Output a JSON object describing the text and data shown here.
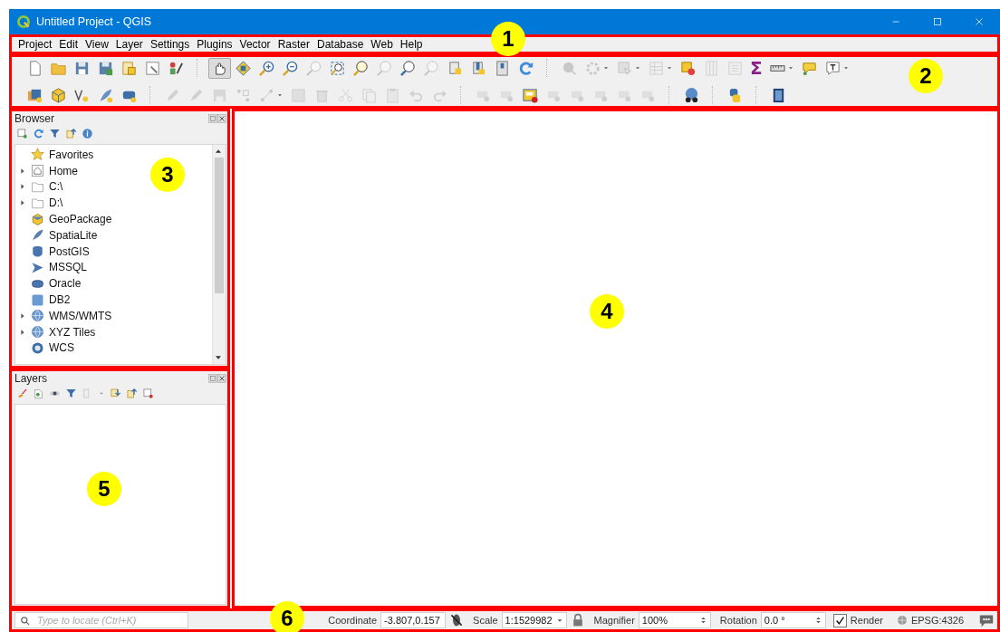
{
  "window": {
    "title": "Untitled Project - QGIS"
  },
  "menu": [
    "Project",
    "Edit",
    "View",
    "Layer",
    "Settings",
    "Plugins",
    "Vector",
    "Raster",
    "Database",
    "Web",
    "Help"
  ],
  "toolbars": [
    {
      "groups": [
        [
          {
            "disabled": false,
            "selected": false
          },
          {
            "disabled": false,
            "selected": false
          },
          {
            "disabled": false,
            "selected": false
          },
          {
            "disabled": false,
            "selected": false
          },
          {
            "disabled": false,
            "selected": false
          },
          {
            "disabled": false,
            "selected": false
          },
          {
            "disabled": false,
            "selected": false
          }
        ],
        [
          {
            "disabled": false,
            "selected": true
          },
          {
            "disabled": false,
            "selected": false
          },
          {
            "disabled": false,
            "selected": false
          },
          {
            "disabled": false,
            "selected": false
          },
          {
            "disabled": true,
            "selected": false
          },
          {
            "disabled": false,
            "selected": false
          },
          {
            "disabled": false,
            "selected": false
          },
          {
            "disabled": true,
            "selected": false
          },
          {
            "disabled": false,
            "selected": false
          },
          {
            "disabled": true,
            "selected": false
          },
          {
            "disabled": false,
            "selected": false
          },
          {
            "disabled": false,
            "selected": false
          },
          {
            "disabled": false,
            "selected": false
          },
          {
            "disabled": false,
            "selected": false
          }
        ],
        [
          {
            "disabled": true,
            "selected": false
          },
          {
            "disabled": true,
            "selected": false,
            "dropdown": true
          },
          {
            "disabled": true,
            "selected": false,
            "dropdown": true
          },
          {
            "disabled": true,
            "selected": false,
            "dropdown": true
          },
          {
            "disabled": false,
            "selected": false
          },
          {
            "disabled": true,
            "selected": false
          },
          {
            "disabled": true,
            "selected": false
          },
          {
            "disabled": false,
            "selected": false,
            "label": "Σ"
          },
          {
            "disabled": false,
            "selected": false,
            "dropdown": true
          },
          {
            "disabled": false,
            "selected": false
          },
          {
            "disabled": false,
            "selected": false,
            "dropdown": true
          }
        ]
      ]
    },
    {
      "groups": [
        [
          {
            "disabled": false,
            "selected": false
          },
          {
            "disabled": false,
            "selected": false
          },
          {
            "disabled": false,
            "selected": false
          },
          {
            "disabled": false,
            "selected": false
          },
          {
            "disabled": false,
            "selected": false
          }
        ],
        [
          {
            "disabled": true,
            "selected": false
          },
          {
            "disabled": true,
            "selected": false
          },
          {
            "disabled": true,
            "selected": false
          },
          {
            "disabled": true,
            "selected": false
          },
          {
            "disabled": true,
            "selected": false,
            "dropdown": true
          },
          {
            "disabled": true,
            "selected": false
          },
          {
            "disabled": true,
            "selected": false
          },
          {
            "disabled": true,
            "selected": false
          },
          {
            "disabled": true,
            "selected": false
          },
          {
            "disabled": true,
            "selected": false
          },
          {
            "disabled": true,
            "selected": false
          },
          {
            "disabled": true,
            "selected": false
          }
        ],
        [
          {
            "disabled": true,
            "selected": false
          },
          {
            "disabled": true,
            "selected": false
          },
          {
            "disabled": false,
            "selected": false
          },
          {
            "disabled": true,
            "selected": false
          },
          {
            "disabled": true,
            "selected": false
          },
          {
            "disabled": true,
            "selected": false
          },
          {
            "disabled": true,
            "selected": false
          },
          {
            "disabled": true,
            "selected": false
          }
        ],
        [
          {
            "disabled": false,
            "selected": false
          }
        ],
        [
          {
            "disabled": false,
            "selected": false
          }
        ],
        [
          {
            "disabled": false,
            "selected": false
          }
        ]
      ]
    }
  ],
  "browser": {
    "title": "Browser",
    "items": [
      {
        "label": "Favorites",
        "expandable": false
      },
      {
        "label": "Home",
        "expandable": true
      },
      {
        "label": "C:\\",
        "expandable": true
      },
      {
        "label": "D:\\",
        "expandable": true
      },
      {
        "label": "GeoPackage",
        "expandable": false
      },
      {
        "label": "SpatiaLite",
        "expandable": false
      },
      {
        "label": "PostGIS",
        "expandable": false
      },
      {
        "label": "MSSQL",
        "expandable": false
      },
      {
        "label": "Oracle",
        "expandable": false
      },
      {
        "label": "DB2",
        "expandable": false
      },
      {
        "label": "WMS/WMTS",
        "expandable": true
      },
      {
        "label": "XYZ Tiles",
        "expandable": true
      },
      {
        "label": "WCS",
        "expandable": false
      }
    ]
  },
  "layers": {
    "title": "Layers"
  },
  "status_bar": {
    "locator": {
      "placeholder": "Type to locate (Ctrl+K)"
    },
    "coordinate": {
      "label": "Coordinate",
      "value": "-3.807,0.157"
    },
    "scale": {
      "label": "Scale",
      "value": "1:1529982"
    },
    "magnifier": {
      "label": "Magnifier",
      "value": "100%"
    },
    "rotation": {
      "label": "Rotation",
      "value": "0.0 °"
    },
    "render": {
      "label": "Render",
      "checked": true
    },
    "crs": {
      "label": "EPSG:4326"
    }
  },
  "annotations": [
    {
      "number": "1"
    },
    {
      "number": "2"
    },
    {
      "number": "3"
    },
    {
      "number": "4"
    },
    {
      "number": "5"
    },
    {
      "number": "6"
    }
  ]
}
